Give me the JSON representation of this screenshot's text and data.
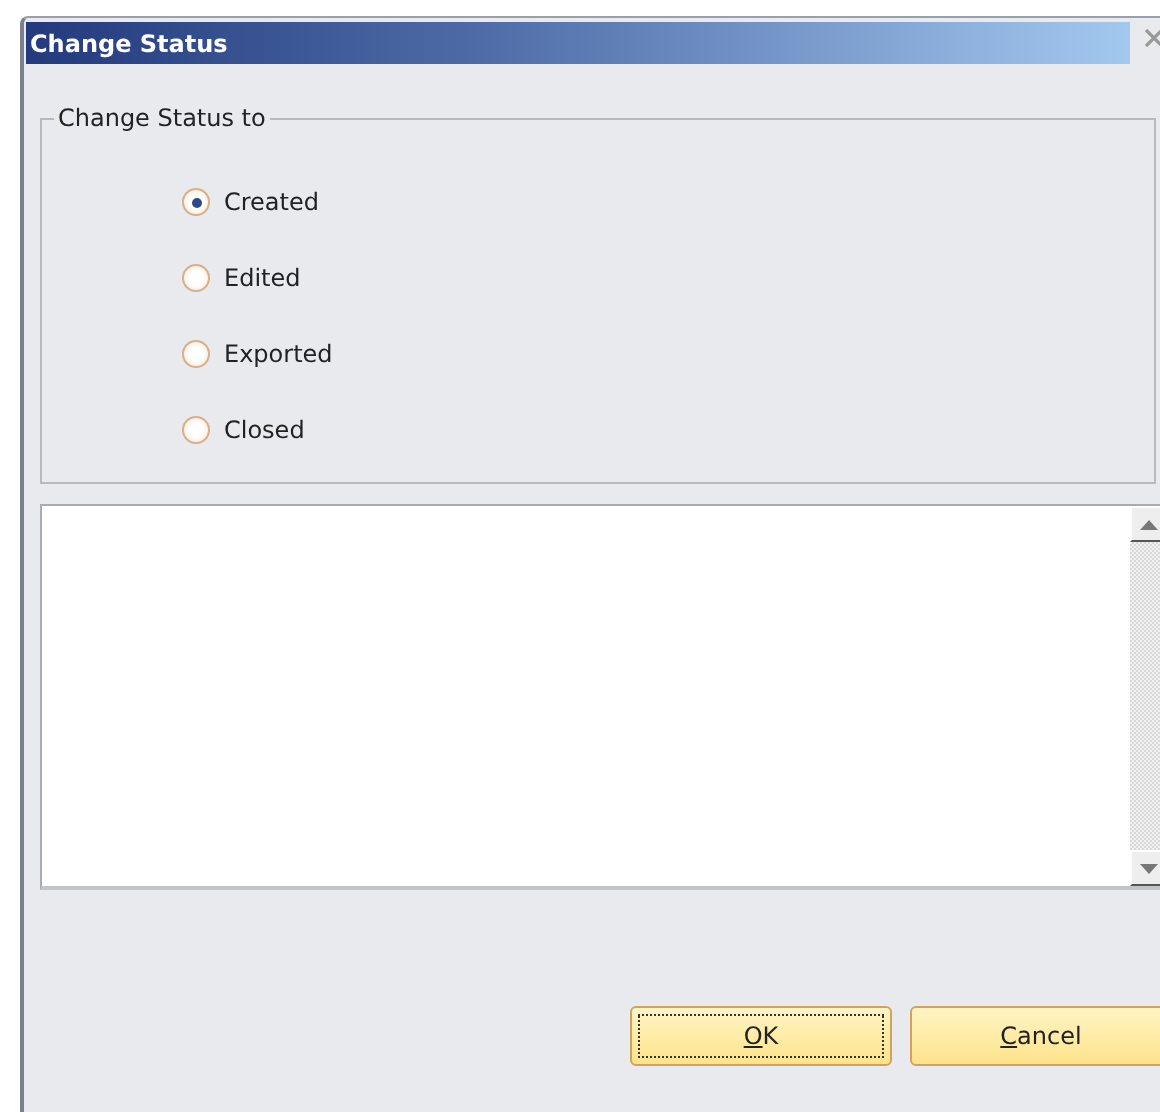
{
  "window": {
    "title": "Change Status"
  },
  "status_group": {
    "legend": "Change Status to",
    "options": [
      {
        "label": "Created",
        "selected": true
      },
      {
        "label": "Edited",
        "selected": false
      },
      {
        "label": "Exported",
        "selected": false
      },
      {
        "label": "Closed",
        "selected": false
      }
    ]
  },
  "buttons": [
    {
      "label": "OK",
      "underline_first": true,
      "focused": true
    },
    {
      "label": "Cancel",
      "underline_first": true,
      "focused": false
    }
  ]
}
